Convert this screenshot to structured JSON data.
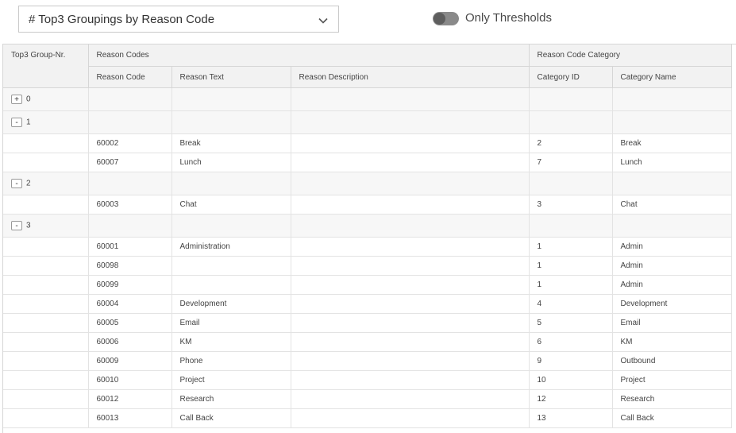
{
  "header": {
    "dropdown_value": "# Top3 Groupings by Reason Code",
    "toggle_label": "Only Thresholds"
  },
  "table": {
    "group_headers": {
      "top3": "Top3 Group-Nr.",
      "reason_codes": "Reason Codes",
      "category": "Reason Code Category"
    },
    "columns": {
      "reason_code": "Reason Code",
      "reason_text": "Reason Text",
      "reason_description": "Reason Description",
      "category_id": "Category ID",
      "category_name": "Category Name"
    },
    "rows": [
      {
        "type": "group",
        "toggle": "+",
        "group": "0"
      },
      {
        "type": "group",
        "toggle": "-",
        "group": "1"
      },
      {
        "type": "data",
        "code": "60002",
        "text": "Break",
        "desc": "",
        "cat_id": "2",
        "cat_name": "Break"
      },
      {
        "type": "data",
        "code": "60007",
        "text": "Lunch",
        "desc": "",
        "cat_id": "7",
        "cat_name": "Lunch"
      },
      {
        "type": "group",
        "toggle": "-",
        "group": "2"
      },
      {
        "type": "data",
        "code": "60003",
        "text": "Chat",
        "desc": "",
        "cat_id": "3",
        "cat_name": "Chat"
      },
      {
        "type": "group",
        "toggle": "-",
        "group": "3"
      },
      {
        "type": "data",
        "code": "60001",
        "text": "Administration",
        "desc": "",
        "cat_id": "1",
        "cat_name": "Admin"
      },
      {
        "type": "data",
        "code": "60098",
        "text": "",
        "desc": "",
        "cat_id": "1",
        "cat_name": "Admin"
      },
      {
        "type": "data",
        "code": "60099",
        "text": "",
        "desc": "",
        "cat_id": "1",
        "cat_name": "Admin"
      },
      {
        "type": "data",
        "code": "60004",
        "text": "Development",
        "desc": "",
        "cat_id": "4",
        "cat_name": "Development"
      },
      {
        "type": "data",
        "code": "60005",
        "text": "Email",
        "desc": "",
        "cat_id": "5",
        "cat_name": "Email"
      },
      {
        "type": "data",
        "code": "60006",
        "text": "KM",
        "desc": "",
        "cat_id": "6",
        "cat_name": "KM"
      },
      {
        "type": "data",
        "code": "60009",
        "text": "Phone",
        "desc": "",
        "cat_id": "9",
        "cat_name": "Outbound"
      },
      {
        "type": "data",
        "code": "60010",
        "text": "Project",
        "desc": "",
        "cat_id": "10",
        "cat_name": "Project"
      },
      {
        "type": "data",
        "code": "60012",
        "text": "Research",
        "desc": "",
        "cat_id": "12",
        "cat_name": "Research"
      },
      {
        "type": "data",
        "code": "60013",
        "text": "Call Back",
        "desc": "",
        "cat_id": "13",
        "cat_name": "Call Back"
      }
    ]
  }
}
